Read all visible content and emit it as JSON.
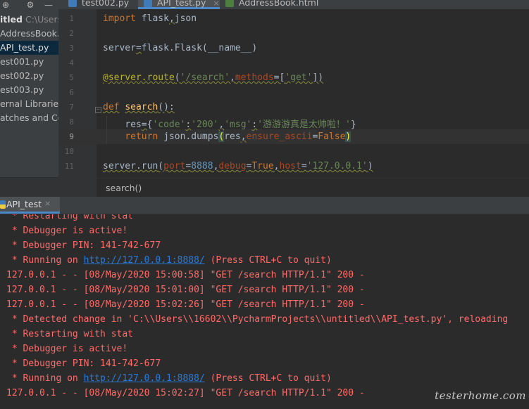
{
  "sidebar": {
    "toolbar_icons": [
      "target-icon",
      "gear-icon",
      "minus-icon"
    ],
    "root": {
      "title": "itled",
      "path": "C:\\Users\\"
    },
    "items": [
      {
        "label": "AddressBook.h"
      },
      {
        "label": "API_test.py",
        "selected": true
      },
      {
        "label": "est001.py"
      },
      {
        "label": "est002.py"
      },
      {
        "label": "est003.py"
      },
      {
        "label": "ernal Libraries"
      },
      {
        "label": "atches and Cor"
      }
    ]
  },
  "tabs": [
    {
      "label": "test002.py",
      "color": "#3e7bb8"
    },
    {
      "label": "API_test.py",
      "color": "#3e7bb8",
      "active": true
    },
    {
      "label": "AddressBook.html",
      "color": "#4d7f3d"
    }
  ],
  "tab_close": "×",
  "editor": {
    "line_numbers": [
      "1",
      "2",
      "3",
      "4",
      "5",
      "6",
      "7",
      "8",
      "9",
      "10",
      "11"
    ],
    "current_line": "9",
    "code": {
      "l1_kw": "import",
      "l1_mod1": " flask",
      "l1_comma": ",",
      "l1_mod2": "json",
      "l3_var": "server",
      "l3_eq": "=",
      "l3_rest": "flask.Flask(__name__)",
      "l5_deco": "@server.route",
      "l5_open": "(",
      "l5_str": "'/search'",
      "l5_comma": ",",
      "l5_param": "methods",
      "l5_eq": "=[",
      "l5_get": "'get'",
      "l5_close": "])",
      "l7_kw": "def",
      "l7_fn": "search",
      "l7_rest": "():",
      "l8_var": "res",
      "l8_eq": "=",
      "l8_open": "{",
      "l8_k1": "'code'",
      "l8_c1": ":",
      "l8_v1": "'200'",
      "l8_comma": ",",
      "l8_k2": "'msg'",
      "l8_c2": ":",
      "l8_v2": "'游游游真是太帅啦！'",
      "l8_close": "}",
      "l9_kw": "return",
      "l9_mid": " json.dumps",
      "l9_open": "(",
      "l9_res": "res",
      "l9_comma": ",",
      "l9_param": "ensure_ascii",
      "l9_eq": "=",
      "l9_val": "False",
      "l9_close": ")",
      "l11_call": "server.run",
      "l11_open": "(",
      "l11_p1": "port",
      "l11_e1": "=",
      "l11_v1": "8888",
      "l11_cm1": ",",
      "l11_p2": "debug",
      "l11_e2": "=",
      "l11_v2": "True",
      "l11_cm2": ",",
      "l11_p3": "host",
      "l11_e3": "=",
      "l11_v3": "'127.0.0.1'",
      "l11_close": ")"
    },
    "breadcrumb": "search()"
  },
  "run_panel": {
    "tab_label": "API_test",
    "tab_close": "×",
    "lines": {
      "l0": " * Restarting with stat",
      "l1": " * Debugger is active!",
      "l2": " * Debugger PIN: 141-742-677",
      "l3_pre": " * Running on ",
      "l3_url": "http://127.0.0.1:8888/",
      "l3_post": " (Press CTRL+C to quit)",
      "l4": "127.0.0.1 - - [08/May/2020 15:00:58] \"GET /search HTTP/1.1\" 200 -",
      "l5": "127.0.0.1 - - [08/May/2020 15:01:00] \"GET /search HTTP/1.1\" 200 -",
      "l6": "127.0.0.1 - - [08/May/2020 15:02:26] \"GET /search HTTP/1.1\" 200 -",
      "l7": " * Detected change in 'C:\\\\Users\\\\16602\\\\PycharmProjects\\\\untitled\\\\API_test.py', reloading",
      "l8": " * Restarting with stat",
      "l9": " * Debugger is active!",
      "l10": " * Debugger PIN: 141-742-677",
      "l11_pre": " * Running on ",
      "l11_url": "http://127.0.0.1:8888/",
      "l11_post": " (Press CTRL+C to quit)",
      "l12": "127.0.0.1 - - [08/May/2020 15:02:27] \"GET /search HTTP/1.1\" 200 -"
    }
  },
  "watermark": "testerhome.com",
  "colors": {
    "keyword": "#cc7832",
    "string": "#6a8759",
    "function": "#ffc66d",
    "decorator": "#bbb529",
    "param": "#aa4926",
    "console_text": "#ff6b68",
    "link": "#287bde"
  }
}
